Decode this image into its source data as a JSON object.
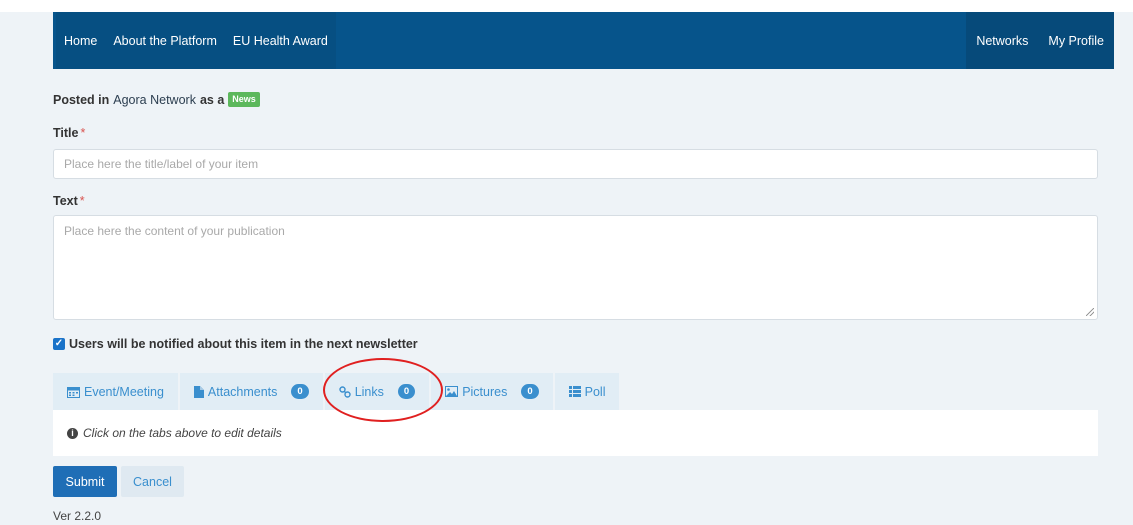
{
  "nav": {
    "left": [
      "Home",
      "About the Platform",
      "EU Health Award"
    ],
    "right": [
      "Networks",
      "My Profile"
    ]
  },
  "posted": {
    "prefix": "Posted in",
    "network": "Agora Network",
    "as": "as a",
    "type_badge": "News"
  },
  "form": {
    "title_label": "Title",
    "title_placeholder": "Place here the title/label of your item",
    "text_label": "Text",
    "text_placeholder": "Place here the content of your publication",
    "required_marker": "*",
    "notify_label": "Users will be notified about this item in the next newsletter",
    "notify_checked": true
  },
  "tabs": [
    {
      "label": "Event/Meeting",
      "icon": "calendar-icon"
    },
    {
      "label": "Attachments",
      "icon": "file-icon",
      "count": "0"
    },
    {
      "label": "Links",
      "icon": "link-icon",
      "count": "0"
    },
    {
      "label": "Pictures",
      "icon": "image-icon",
      "count": "0"
    },
    {
      "label": "Poll",
      "icon": "list-icon"
    }
  ],
  "tab_hint": "Click on the tabs above to edit details",
  "buttons": {
    "submit": "Submit",
    "cancel": "Cancel"
  },
  "version": "Ver 2.2.0",
  "colors": {
    "navbar": "#06548b",
    "accent": "#3a8fce",
    "badge_green": "#5cb85c",
    "submit": "#1f6eb6",
    "annotation": "#e02020"
  }
}
